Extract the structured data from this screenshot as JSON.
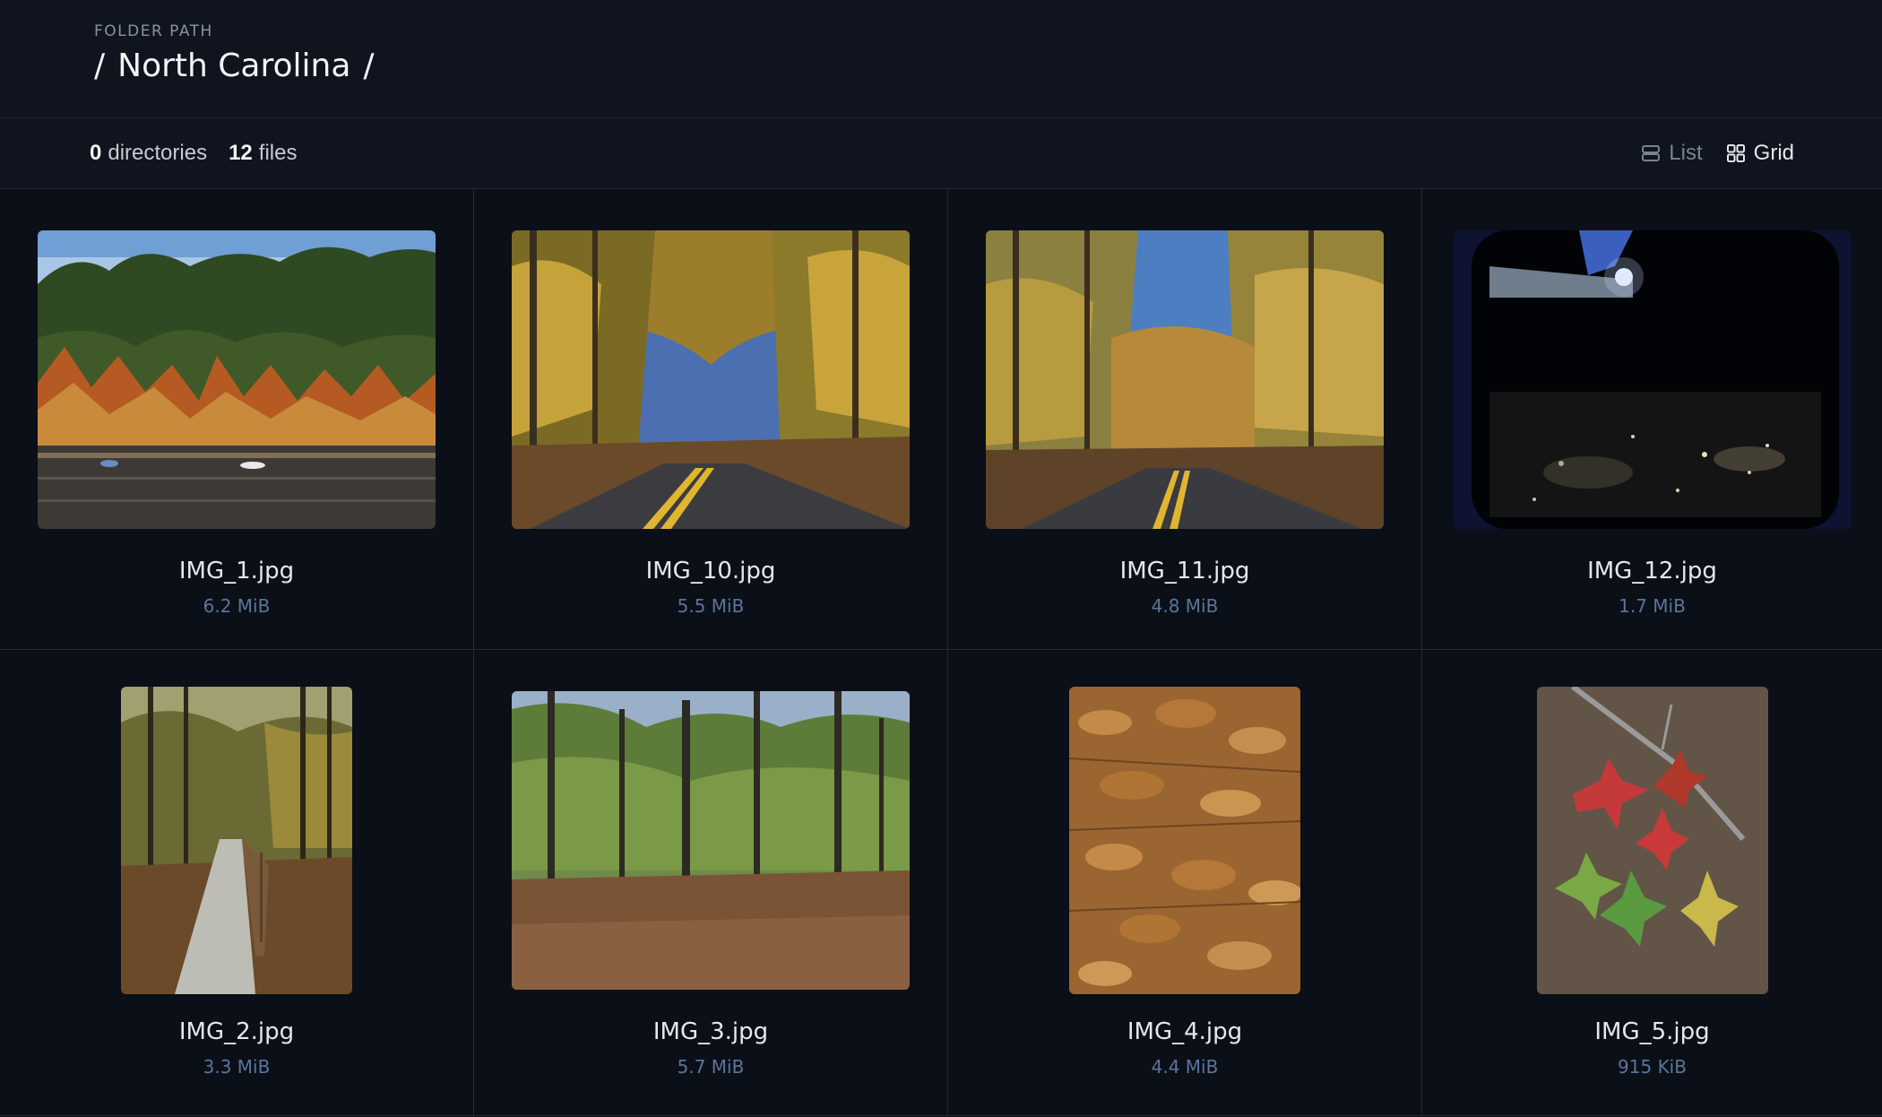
{
  "header": {
    "label": "FOLDER PATH",
    "separator": "/",
    "folder": "North Carolina"
  },
  "toolbar": {
    "directories_count": "0",
    "directories_label": "directories",
    "files_count": "12",
    "files_label": "files",
    "list_label": "List",
    "grid_label": "Grid"
  },
  "files": [
    {
      "name": "IMG_1.jpg",
      "size": "6.2 MiB",
      "thumbnail": "autumn-lake-kayaks"
    },
    {
      "name": "IMG_10.jpg",
      "size": "5.5 MiB",
      "thumbnail": "autumn-forest-road"
    },
    {
      "name": "IMG_11.jpg",
      "size": "4.8 MiB",
      "thumbnail": "autumn-forest-road-curve"
    },
    {
      "name": "IMG_12.jpg",
      "size": "1.7 MiB",
      "thumbnail": "night-city-airplane-window"
    },
    {
      "name": "IMG_2.jpg",
      "size": "3.3 MiB",
      "thumbnail": "forest-boardwalk-trail"
    },
    {
      "name": "IMG_3.jpg",
      "size": "5.7 MiB",
      "thumbnail": "forest-floor-leaves"
    },
    {
      "name": "IMG_4.jpg",
      "size": "4.4 MiB",
      "thumbnail": "fallen-leaves-closeup"
    },
    {
      "name": "IMG_5.jpg",
      "size": "915 KiB",
      "thumbnail": "maple-leaves-branch"
    }
  ],
  "colors": {
    "background": "#0b0f17",
    "header_background": "#0f141e",
    "border": "#232a36",
    "size_text": "#5b7599"
  }
}
